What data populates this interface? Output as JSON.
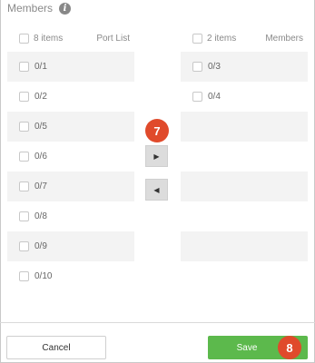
{
  "header": {
    "title": "Members",
    "info_icon": "info-icon"
  },
  "left_panel": {
    "count": "8 items",
    "title": "Port List",
    "items": [
      {
        "label": "0/1"
      },
      {
        "label": "0/2"
      },
      {
        "label": "0/5"
      },
      {
        "label": "0/6"
      },
      {
        "label": "0/7"
      },
      {
        "label": "0/8"
      },
      {
        "label": "0/9"
      },
      {
        "label": "0/10"
      }
    ]
  },
  "right_panel": {
    "count": "2 items",
    "title": "Members",
    "items": [
      {
        "label": "0/3"
      },
      {
        "label": "0/4"
      }
    ]
  },
  "transfer": {
    "move_right_icon": "caret-right-icon",
    "move_left_icon": "caret-left-icon"
  },
  "annotations": {
    "step_transfer": "7",
    "step_save": "8"
  },
  "footer": {
    "cancel_label": "Cancel",
    "save_label": "Save"
  },
  "colors": {
    "save": "#5cb94c",
    "step_badge": "#e04a2b",
    "row_shade": "#f3f3f3"
  }
}
